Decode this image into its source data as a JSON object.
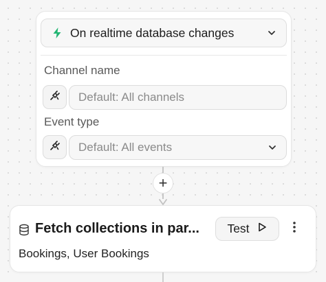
{
  "trigger": {
    "select_label": "On realtime database changes",
    "icon": "bolt-icon",
    "accent_color": "#22b573"
  },
  "fields": {
    "channel": {
      "label": "Channel name",
      "placeholder": "Default: All channels"
    },
    "event": {
      "label": "Event type",
      "placeholder": "Default: All events"
    }
  },
  "add_step": {
    "label": "+"
  },
  "action": {
    "title": "Fetch collections in par...",
    "test_label": "Test",
    "subtitle": "Bookings, User Bookings",
    "icon": "database-icon"
  }
}
